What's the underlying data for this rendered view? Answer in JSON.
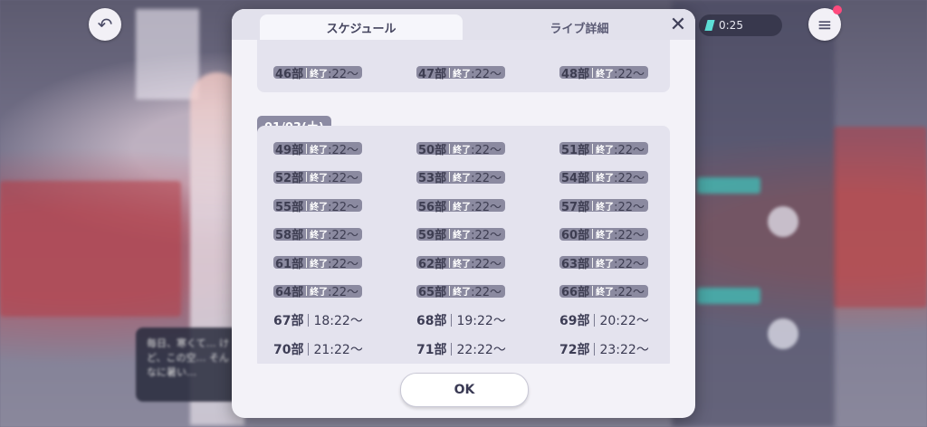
{
  "tabs": [
    {
      "label": "スケジュール",
      "active": true
    },
    {
      "label": "ライブ詳細",
      "active": false
    }
  ],
  "hud": {
    "timer": "0:25",
    "back_icon": "back-arrow-icon",
    "menu_icon": "hamburger-menu-icon"
  },
  "background_chat": "毎日、寒くて… けど、この空… そんなに暑い…",
  "schedule": {
    "status_done": "終了",
    "first_group_parts": [
      {
        "part": "46部",
        "time": ":22〜",
        "done": true
      },
      {
        "part": "47部",
        "time": ":22〜",
        "done": true
      },
      {
        "part": "48部",
        "time": ":22〜",
        "done": true
      }
    ],
    "date": "01/03(土)",
    "parts": [
      {
        "part": "49部",
        "time": ":22〜",
        "done": true
      },
      {
        "part": "50部",
        "time": ":22〜",
        "done": true
      },
      {
        "part": "51部",
        "time": ":22〜",
        "done": true
      },
      {
        "part": "52部",
        "time": ":22〜",
        "done": true
      },
      {
        "part": "53部",
        "time": ":22〜",
        "done": true
      },
      {
        "part": "54部",
        "time": ":22〜",
        "done": true
      },
      {
        "part": "55部",
        "time": ":22〜",
        "done": true
      },
      {
        "part": "56部",
        "time": ":22〜",
        "done": true
      },
      {
        "part": "57部",
        "time": ":22〜",
        "done": true
      },
      {
        "part": "58部",
        "time": ":22〜",
        "done": true
      },
      {
        "part": "59部",
        "time": ":22〜",
        "done": true
      },
      {
        "part": "60部",
        "time": ":22〜",
        "done": true
      },
      {
        "part": "61部",
        "time": ":22〜",
        "done": true
      },
      {
        "part": "62部",
        "time": ":22〜",
        "done": true
      },
      {
        "part": "63部",
        "time": ":22〜",
        "done": true
      },
      {
        "part": "64部",
        "time": ":22〜",
        "done": true
      },
      {
        "part": "65部",
        "time": ":22〜",
        "done": true
      },
      {
        "part": "66部",
        "time": ":22〜",
        "done": true
      },
      {
        "part": "67部",
        "time": "18:22〜",
        "done": false
      },
      {
        "part": "68部",
        "time": "19:22〜",
        "done": false
      },
      {
        "part": "69部",
        "time": "20:22〜",
        "done": false
      },
      {
        "part": "70部",
        "time": "21:22〜",
        "done": false
      },
      {
        "part": "71部",
        "time": "22:22〜",
        "done": false
      },
      {
        "part": "72部",
        "time": "23:22〜",
        "done": false
      }
    ]
  },
  "ok_label": "OK",
  "close_icon": "close-x-icon"
}
